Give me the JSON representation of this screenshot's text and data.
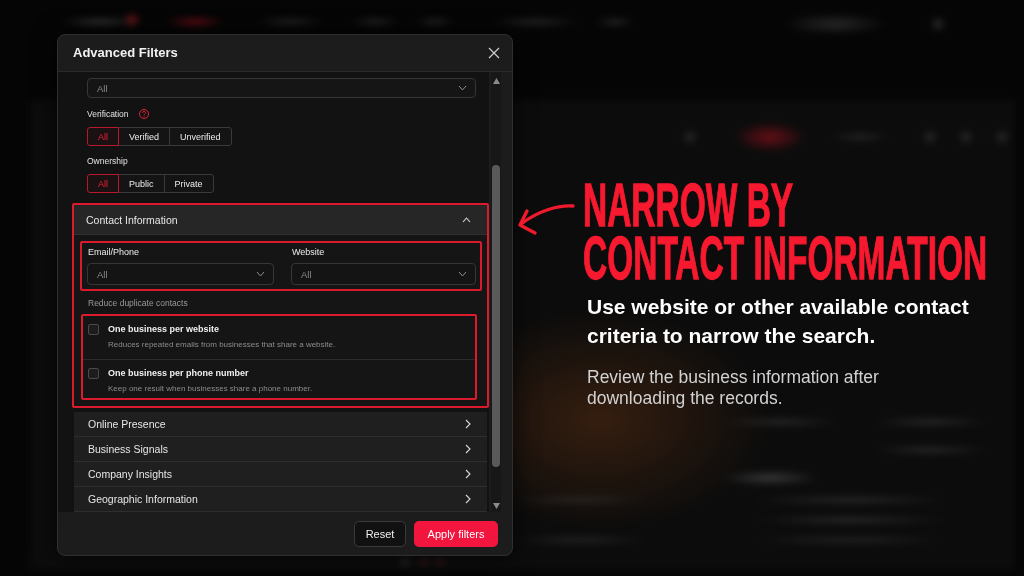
{
  "dialog": {
    "title": "Advanced Filters",
    "top_select": {
      "value": "All"
    },
    "toggle_groups": [
      {
        "label": "Verification",
        "help": true,
        "options": [
          {
            "label": "All",
            "selected": true
          },
          {
            "label": "Verified",
            "selected": false
          },
          {
            "label": "Unverified",
            "selected": false
          }
        ]
      },
      {
        "label": "Ownership",
        "options": [
          {
            "label": "All",
            "selected": true
          },
          {
            "label": "Public",
            "selected": false
          },
          {
            "label": "Private",
            "selected": false
          }
        ]
      }
    ],
    "sections": [
      {
        "title": "Contact Information",
        "expanded": true,
        "highlighted": true,
        "fields": {
          "highlighted": true,
          "items": [
            {
              "label": "Email/Phone",
              "value": "All"
            },
            {
              "label": "Website",
              "value": "All"
            }
          ]
        },
        "dedupe": {
          "label": "Reduce duplicate contacts",
          "highlighted": true,
          "options": [
            {
              "title": "One business per website",
              "description": "Reduces repeated emails from businesses that share a website.",
              "checked": false
            },
            {
              "title": "One business per phone number",
              "description": "Keep one result when businesses share a phone number.",
              "checked": false
            }
          ]
        }
      },
      {
        "title": "Online Presence",
        "expanded": false,
        "highlighted": false
      },
      {
        "title": "Business Signals",
        "expanded": false,
        "highlighted": false
      },
      {
        "title": "Company Insights",
        "expanded": false,
        "highlighted": false
      },
      {
        "title": "Geographic Information",
        "expanded": false,
        "highlighted": false
      }
    ],
    "buttons": [
      {
        "label": "Reset",
        "kind": "secondary"
      },
      {
        "label": "Apply filters",
        "kind": "primary"
      }
    ]
  },
  "callout": {
    "headline": "NARROW BY\nCONTACT INFORMATION",
    "lead": "Use website or other available contact criteria to narrow the search.",
    "note": "Review the business information after downloading the records."
  }
}
